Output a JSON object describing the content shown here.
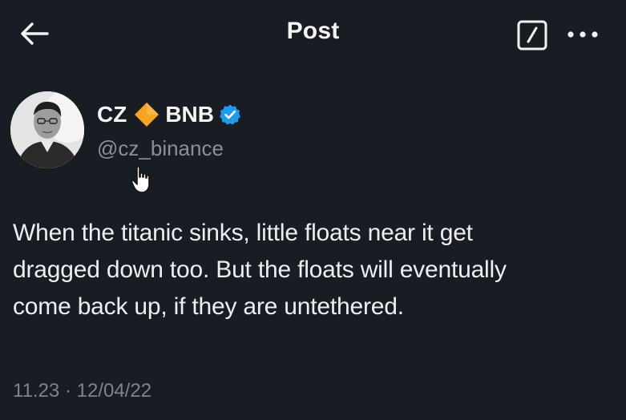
{
  "header": {
    "title": "Post",
    "back_icon": "arrow-left-icon",
    "edit_icon": "edit-square-icon",
    "more_icon": "more-horizontal-icon"
  },
  "author": {
    "name_first": "CZ",
    "name_last": "BNB",
    "diamond_icon": "orange-diamond-icon",
    "verified_icon": "verified-badge-icon",
    "handle": "@cz_binance"
  },
  "tweet": {
    "lines": [
      "When the titanic sinks, little floats near it get",
      "dragged down too. But the floats will eventually",
      "come back up, if they are untethered."
    ]
  },
  "meta": {
    "time": "11.23",
    "separator": "·",
    "date": "12/04/22"
  },
  "colors": {
    "background": "#1a1c24",
    "text": "#f4f5f7",
    "muted": "#8a8f98",
    "diamond": "#f7a425",
    "verified": "#1d9bf0"
  }
}
